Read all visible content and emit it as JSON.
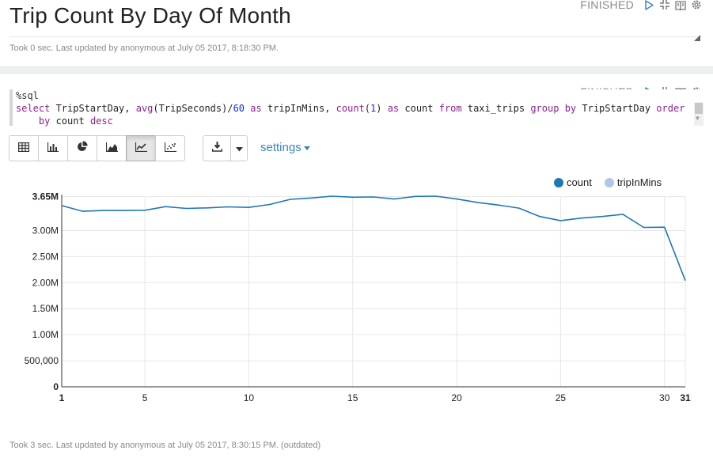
{
  "paragraph1": {
    "title": "Trip Count By Day Of Month",
    "status": "FINISHED",
    "footer": "Took 0 sec. Last updated by anonymous at July 05 2017, 8:18:30 PM."
  },
  "paragraph2": {
    "status": "FINISHED",
    "code": {
      "directive": "%sql",
      "line1_tokens": [
        {
          "t": "select",
          "c": "kw"
        },
        {
          "t": " TripStartDay, ",
          "c": "id"
        },
        {
          "t": "avg",
          "c": "kw"
        },
        {
          "t": "(TripSeconds)/",
          "c": "id"
        },
        {
          "t": "60",
          "c": "num"
        },
        {
          "t": " ",
          "c": "id"
        },
        {
          "t": "as",
          "c": "kw"
        },
        {
          "t": " tripInMins, ",
          "c": "id"
        },
        {
          "t": "count",
          "c": "kw"
        },
        {
          "t": "(",
          "c": "id"
        },
        {
          "t": "1",
          "c": "num"
        },
        {
          "t": ") ",
          "c": "id"
        },
        {
          "t": "as",
          "c": "kw"
        },
        {
          "t": " count ",
          "c": "id"
        },
        {
          "t": "from",
          "c": "kw"
        },
        {
          "t": " taxi_trips ",
          "c": "id"
        },
        {
          "t": "group",
          "c": "kw"
        },
        {
          "t": " ",
          "c": "id"
        },
        {
          "t": "by",
          "c": "kw"
        },
        {
          "t": " TripStartDay ",
          "c": "id"
        },
        {
          "t": "order",
          "c": "kw"
        }
      ],
      "line2_tokens": [
        {
          "t": "    ",
          "c": "id"
        },
        {
          "t": "by",
          "c": "kw"
        },
        {
          "t": " count ",
          "c": "id"
        },
        {
          "t": "desc",
          "c": "kw"
        }
      ]
    },
    "toolbar": {
      "buttons": [
        {
          "name": "table",
          "icon": "table-icon",
          "active": false
        },
        {
          "name": "bar",
          "icon": "bar-chart-icon",
          "active": false
        },
        {
          "name": "pie",
          "icon": "pie-chart-icon",
          "active": false
        },
        {
          "name": "area",
          "icon": "area-chart-icon",
          "active": false
        },
        {
          "name": "line",
          "icon": "line-chart-icon",
          "active": true
        },
        {
          "name": "scatter",
          "icon": "scatter-chart-icon",
          "active": false
        }
      ],
      "settings_label": "settings"
    },
    "footer": "Took 3 sec. Last updated by anonymous at July 05 2017, 8:30:15 PM. (outdated)"
  },
  "colors": {
    "count": "#1f77b4",
    "tripInMins": "#aec7e8",
    "link": "#3a84c4"
  },
  "chart_data": {
    "type": "line",
    "title": "",
    "xlabel": "",
    "ylabel": "",
    "x": [
      1,
      2,
      3,
      4,
      5,
      6,
      7,
      8,
      9,
      10,
      11,
      12,
      13,
      14,
      15,
      16,
      17,
      18,
      19,
      20,
      21,
      22,
      23,
      24,
      25,
      26,
      27,
      28,
      29,
      30,
      31
    ],
    "series": [
      {
        "name": "count",
        "values": [
          3480000,
          3370000,
          3385000,
          3385000,
          3390000,
          3460000,
          3425000,
          3435000,
          3455000,
          3445000,
          3500000,
          3600000,
          3625000,
          3660000,
          3640000,
          3645000,
          3605000,
          3655000,
          3660000,
          3605000,
          3540000,
          3490000,
          3430000,
          3270000,
          3190000,
          3240000,
          3270000,
          3310000,
          3060000,
          3065000,
          2040000
        ]
      },
      {
        "name": "tripInMins",
        "values": []
      }
    ],
    "ylim": [
      0,
      3660000
    ],
    "xlim": [
      1,
      31
    ],
    "y_ticks": [
      {
        "v": 0,
        "label": "0"
      },
      {
        "v": 500000,
        "label": "500,000"
      },
      {
        "v": 1000000,
        "label": "1.00M"
      },
      {
        "v": 1500000,
        "label": "1.50M"
      },
      {
        "v": 2000000,
        "label": "2.00M"
      },
      {
        "v": 2500000,
        "label": "2.50M"
      },
      {
        "v": 3000000,
        "label": "3.00M"
      },
      {
        "v": 3650000,
        "label": "3.65M"
      }
    ],
    "x_ticks": [
      {
        "v": 1,
        "label": "1"
      },
      {
        "v": 5,
        "label": "5"
      },
      {
        "v": 10,
        "label": "10"
      },
      {
        "v": 15,
        "label": "15"
      },
      {
        "v": 20,
        "label": "20"
      },
      {
        "v": 25,
        "label": "25"
      },
      {
        "v": 30,
        "label": "30"
      },
      {
        "v": 31,
        "label": "31"
      }
    ],
    "grid": true,
    "legend": "top-right"
  }
}
